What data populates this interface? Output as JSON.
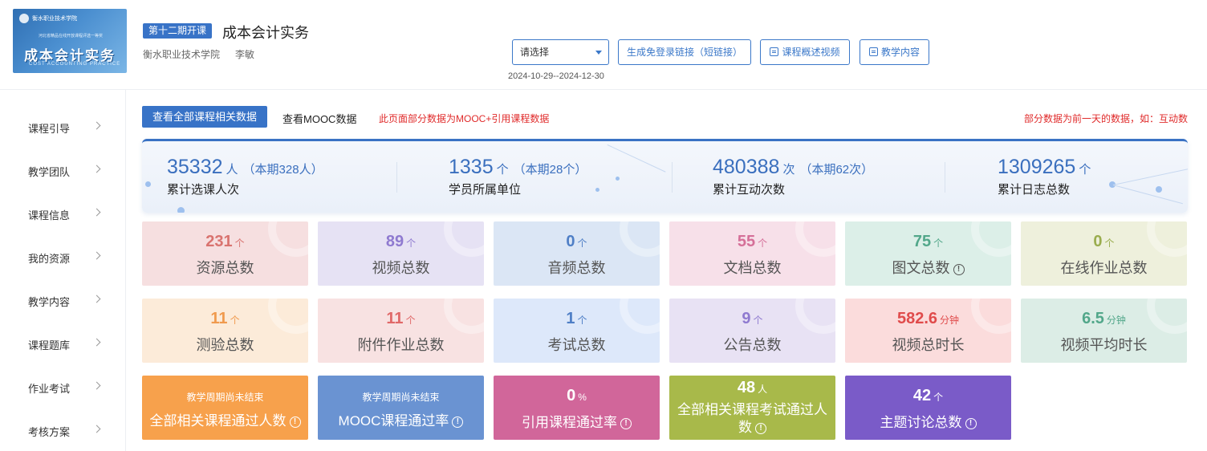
{
  "header": {
    "cover": {
      "school": "衡水职业技术学院",
      "subtitle": "河北省精品在线开放课程评选一等奖",
      "title": "成本会计实务",
      "en": "COST ACCOUNTING PRACTICE"
    },
    "term_badge": "第十二期开课",
    "course_name": "成本会计实务",
    "school_name": "衡水职业技术学院",
    "teacher": "李敏",
    "select_placeholder": "请选择",
    "btn_link": "生成免登录链接（短链接）",
    "btn_video": "课程概述视频",
    "btn_content": "教学内容",
    "date_range": "2024-10-29--2024-12-30"
  },
  "sidebar": {
    "items": [
      {
        "label": "课程引导"
      },
      {
        "label": "教学团队"
      },
      {
        "label": "课程信息"
      },
      {
        "label": "我的资源"
      },
      {
        "label": "教学内容"
      },
      {
        "label": "课程题库"
      },
      {
        "label": "作业考试"
      },
      {
        "label": "考核方案"
      }
    ]
  },
  "main": {
    "tab_all": "查看全部课程相关数据",
    "tab_mooc": "查看MOOC数据",
    "note_left": "此页面部分数据为MOOC+引用课程数据",
    "note_right": "部分数据为前一天的数据，如：互动数"
  },
  "stats": [
    {
      "num": "35332",
      "unit": "人",
      "extra": "（本期328人）",
      "caption": "累计选课人次"
    },
    {
      "num": "1335",
      "unit": "个",
      "extra": "（本期28个）",
      "caption": "学员所属单位"
    },
    {
      "num": "480388",
      "unit": "次",
      "extra": "（本期62次）",
      "caption": "累计互动次数"
    },
    {
      "num": "1309265",
      "unit": "个",
      "extra": "",
      "caption": "累计日志总数"
    }
  ],
  "cards_row1": [
    {
      "value": "231",
      "unit": "个",
      "title": "资源总数",
      "bg": "#f6dfe0",
      "color": "#d9736f"
    },
    {
      "value": "89",
      "unit": "个",
      "title": "视频总数",
      "bg": "#e6e2f4",
      "color": "#8f7ad0"
    },
    {
      "value": "0",
      "unit": "个",
      "title": "音频总数",
      "bg": "#dbe6f5",
      "color": "#4f7fc6"
    },
    {
      "value": "55",
      "unit": "个",
      "title": "文档总数",
      "bg": "#f7e0e9",
      "color": "#d56f98"
    },
    {
      "value": "75",
      "unit": "个",
      "title": "图文总数",
      "bg": "#dcefe8",
      "color": "#52a78a"
    },
    {
      "value": "0",
      "unit": "个",
      "title": "在线作业总数",
      "bg": "#eef0dc",
      "color": "#9aad4e"
    }
  ],
  "cards_row2": [
    {
      "value": "11",
      "unit": "个",
      "title": "测验总数",
      "bg": "#fcebd9",
      "color": "#f09a4e"
    },
    {
      "value": "11",
      "unit": "个",
      "title": "附件作业总数",
      "bg": "#f8e2e2",
      "color": "#e06868"
    },
    {
      "value": "1",
      "unit": "个",
      "title": "考试总数",
      "bg": "#dde8fa",
      "color": "#4f7fc6"
    },
    {
      "value": "9",
      "unit": "个",
      "title": "公告总数",
      "bg": "#e8e2f4",
      "color": "#8f7ad0"
    },
    {
      "value": "582.6",
      "unit": "分钟",
      "title": "视频总时长",
      "bg": "#fbdcdc",
      "color": "#e04b4b"
    },
    {
      "value": "6.5",
      "unit": "分钟",
      "title": "视频平均时长",
      "bg": "#dcede6",
      "color": "#52a78a"
    }
  ],
  "cards_row3": [
    {
      "sub": "教学周期尚未结束",
      "title": "全部相关课程通过人数",
      "bg": "#f7a14c"
    },
    {
      "sub": "教学周期尚未结束",
      "title": "MOOC课程通过率",
      "bg": "#6a93d2"
    },
    {
      "value": "0",
      "unit": "%",
      "title": "引用课程通过率",
      "bg": "#d1669a"
    },
    {
      "value": "48",
      "unit": "人",
      "title": "全部相关课程考试通过人数",
      "bg": "#a8b94a"
    },
    {
      "value": "42",
      "unit": "个",
      "title": "主题讨论总数",
      "bg": "#7a5bc8"
    }
  ]
}
